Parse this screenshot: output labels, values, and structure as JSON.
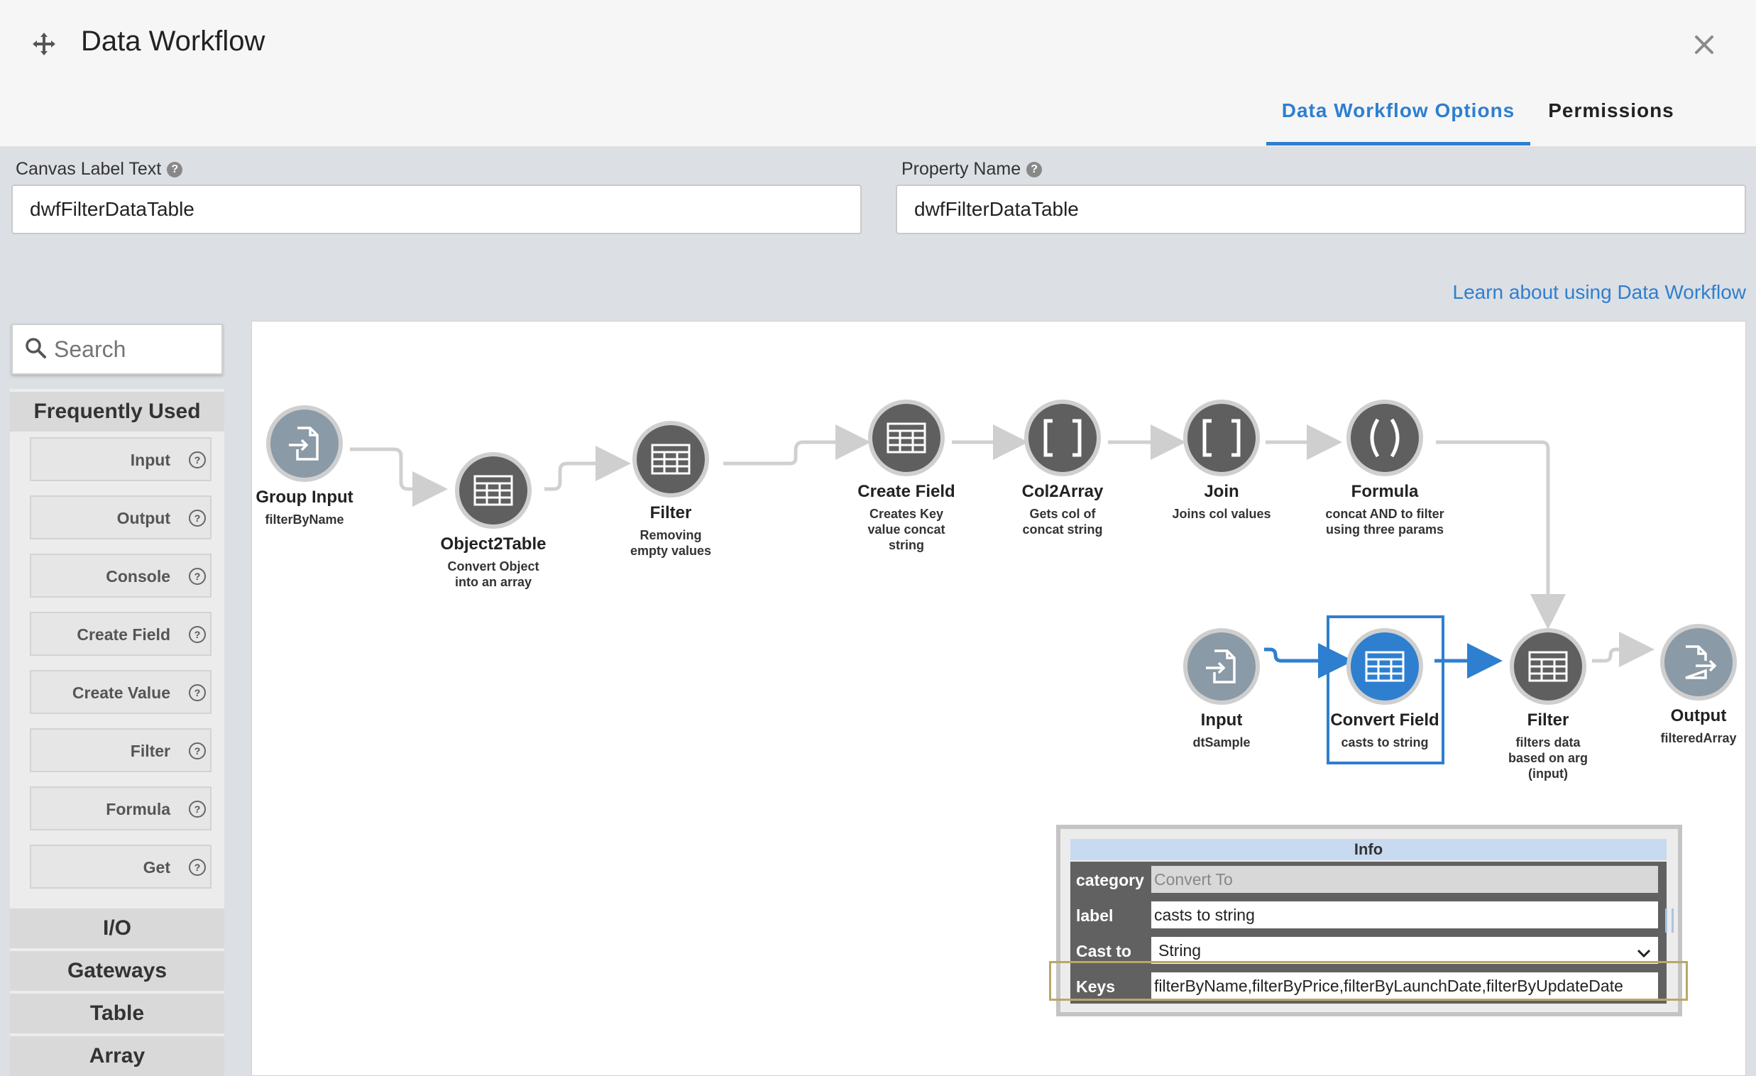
{
  "header": {
    "title": "Data Workflow",
    "tabs": [
      {
        "label": "Data Workflow Options",
        "active": true
      },
      {
        "label": "Permissions",
        "active": false
      }
    ],
    "accent_color": "#2e7fd0"
  },
  "fields": {
    "canvas_label": {
      "label": "Canvas Label Text",
      "value": "dwfFilterDataTable"
    },
    "property_name": {
      "label": "Property Name",
      "value": "dwfFilterDataTable"
    }
  },
  "learn_link": "Learn about using Data Workflow",
  "palette": {
    "search_placeholder": "Search",
    "sections": {
      "frequently_used": "Frequently Used",
      "io": "I/O",
      "gateways": "Gateways",
      "table": "Table",
      "array": "Array"
    },
    "items": [
      "Input",
      "Output",
      "Console",
      "Create Field",
      "Create Value",
      "Filter",
      "Formula",
      "Get"
    ]
  },
  "nodes": [
    {
      "title": "Group Input",
      "desc": "filterByName",
      "icon": "import-file-icon"
    },
    {
      "title": "Object2Table",
      "desc": "Convert Object into an array",
      "icon": "table-icon"
    },
    {
      "title": "Filter",
      "desc": "Removing empty values",
      "icon": "table-icon"
    },
    {
      "title": "Create Field",
      "desc": "Creates Key value concat string",
      "icon": "table-icon"
    },
    {
      "title": "Col2Array",
      "desc": "Gets col of concat string",
      "icon": "brackets-icon"
    },
    {
      "title": "Join",
      "desc": "Joins col values",
      "icon": "brackets-icon"
    },
    {
      "title": "Formula",
      "desc": "concat AND to filter using three params",
      "icon": "parentheses-icon"
    },
    {
      "title": "Input",
      "desc": "dtSample",
      "icon": "import-file-icon"
    },
    {
      "title": "Convert Field",
      "desc": "casts to string",
      "icon": "table-icon",
      "selected": true
    },
    {
      "title": "Filter",
      "desc": "filters data based on arg (input)",
      "icon": "table-icon"
    },
    {
      "title": "Output",
      "desc": "filteredArray",
      "icon": "export-file-icon"
    }
  ],
  "info": {
    "title": "Info",
    "rows": {
      "category": {
        "label": "category",
        "value": "Convert To"
      },
      "label": {
        "label": "label",
        "value": "casts to string"
      },
      "cast_to": {
        "label": "Cast to",
        "value": "String"
      },
      "keys": {
        "label": "Keys",
        "value": "filterByName,filterByPrice,filterByLaunchDate,filterByUpdateDate"
      }
    }
  }
}
